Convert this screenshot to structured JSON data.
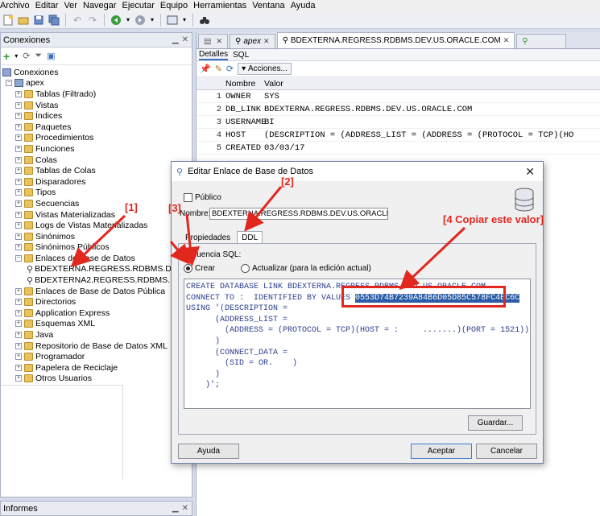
{
  "menu": [
    "Archivo",
    "Editar",
    "Ver",
    "Navegar",
    "Ejecutar",
    "Equipo",
    "Herramientas",
    "Ventana",
    "Ayuda"
  ],
  "left_panel": {
    "title": "Conexiones",
    "tree": [
      {
        "label": "Conexiones",
        "level": 0,
        "icon": "connections-icon"
      },
      {
        "label": "apex",
        "level": 1,
        "icon": "database-connection-icon",
        "expanded": true
      },
      {
        "label": "Tablas (Filtrado)",
        "level": 2,
        "icon": "folder-icon"
      },
      {
        "label": "Vistas",
        "level": 2,
        "icon": "folder-icon"
      },
      {
        "label": "Índices",
        "level": 2,
        "icon": "folder-icon"
      },
      {
        "label": "Paquetes",
        "level": 2,
        "icon": "folder-icon"
      },
      {
        "label": "Procedimientos",
        "level": 2,
        "icon": "folder-icon"
      },
      {
        "label": "Funciones",
        "level": 2,
        "icon": "folder-icon"
      },
      {
        "label": "Colas",
        "level": 2,
        "icon": "folder-icon"
      },
      {
        "label": "Tablas de Colas",
        "level": 2,
        "icon": "folder-icon"
      },
      {
        "label": "Disparadores",
        "level": 2,
        "icon": "folder-icon"
      },
      {
        "label": "Tipos",
        "level": 2,
        "icon": "folder-icon"
      },
      {
        "label": "Secuencias",
        "level": 2,
        "icon": "folder-icon"
      },
      {
        "label": "Vistas Materializadas",
        "level": 2,
        "icon": "folder-icon"
      },
      {
        "label": "Logs de Vistas Materializadas",
        "level": 2,
        "icon": "folder-icon"
      },
      {
        "label": "Sinónimos",
        "level": 2,
        "icon": "folder-icon"
      },
      {
        "label": "Sinónimos Públicos",
        "level": 2,
        "icon": "folder-icon"
      },
      {
        "label": "Enlaces de Base de Datos",
        "level": 2,
        "icon": "folder-icon",
        "expanded": true
      },
      {
        "label": "BDEXTERNA.REGRESS.RDBMS.DEV.US",
        "level": 3,
        "icon": "db-link-icon"
      },
      {
        "label": "BDEXTERNA2.REGRESS.RDBMS.DEV.US",
        "level": 3,
        "icon": "db-link-icon"
      },
      {
        "label": "Enlaces de Base de Datos Pública",
        "level": 2,
        "icon": "folder-icon"
      },
      {
        "label": "Directorios",
        "level": 2,
        "icon": "folder-icon"
      },
      {
        "label": "Application Express",
        "level": 2,
        "icon": "folder-icon"
      },
      {
        "label": "Esquemas XML",
        "level": 2,
        "icon": "folder-icon"
      },
      {
        "label": "Java",
        "level": 2,
        "icon": "folder-icon"
      },
      {
        "label": "Repositorio de Base de Datos XML",
        "level": 2,
        "icon": "folder-icon"
      },
      {
        "label": "Programador",
        "level": 2,
        "icon": "folder-icon"
      },
      {
        "label": "Papelera de Reciclaje",
        "level": 2,
        "icon": "folder-icon"
      },
      {
        "label": "Otros Usuarios",
        "level": 2,
        "icon": "folder-icon"
      }
    ],
    "bottom_title": "Informes"
  },
  "editor": {
    "tabs": [
      {
        "label": "",
        "icon": "worksheet-icon"
      },
      {
        "label": "apex",
        "icon": "db-link-icon"
      },
      {
        "label": "BDEXTERNA.REGRESS.RDBMS.DEV.US.ORACLE.COM",
        "icon": "db-link-icon",
        "active": true
      },
      {
        "label": "",
        "icon": "db-link-icon"
      }
    ],
    "subtabs": [
      "Detalles",
      "SQL"
    ],
    "actions_label": "Acciones...",
    "columns": [
      "Nombre",
      "Valor"
    ],
    "rows": [
      {
        "n": "1",
        "name": "OWNER",
        "value": "SYS"
      },
      {
        "n": "2",
        "name": "DB_LINK",
        "value": "BDEXTERNA.REGRESS.RDBMS.DEV.US.ORACLE.COM"
      },
      {
        "n": "3",
        "name": "USERNAME",
        "value": "BI"
      },
      {
        "n": "4",
        "name": "HOST",
        "value": "(DESCRIPTION =        (ADDRESS_LIST =          (ADDRESS = (PROTOCOL = TCP)(HO"
      },
      {
        "n": "5",
        "name": "CREATED",
        "value": "03/03/17"
      }
    ]
  },
  "dialog": {
    "title": "Editar Enlace de Base de Datos",
    "public_label": "Público",
    "name_label": "Nombre:",
    "name_value": "BDEXTERNA.REGRESS.RDBMS.DEV.US.ORACLE.COM",
    "tabs": [
      "Propiedades",
      "DDL"
    ],
    "sequence_label": "Secuencia SQL:",
    "radio_create": "Crear",
    "radio_update": "Actualizar (para la edición actual)",
    "sql_lines": [
      "CREATE DATABASE LINK BDEXTERNA.REGRESS.RDBMS.DEV.US.ORACLE.COM",
      "CONNECT TO :  IDENTIFIED BY VALUES ",
      "USING '(DESCRIPTION =",
      "      (ADDRESS_LIST =",
      "        (ADDRESS = (PROTOCOL = TCP)(HOST = :     .......)(PORT = 1521))",
      "      )",
      "      (CONNECT_DATA =",
      "        (SID = OR.    )",
      "      )",
      "    )';"
    ],
    "hash_value": "0553D74B7239A84B6D05D85C578FC4EC6C",
    "save_button": "Guardar...",
    "help_button": "Ayuda",
    "accept_button": "Aceptar",
    "cancel_button": "Cancelar"
  },
  "annotations": {
    "a1": "[1]",
    "a2": "[2]",
    "a3": "[3]",
    "a4": "[4 Copiar este valor]",
    "color": "#e2271f"
  }
}
